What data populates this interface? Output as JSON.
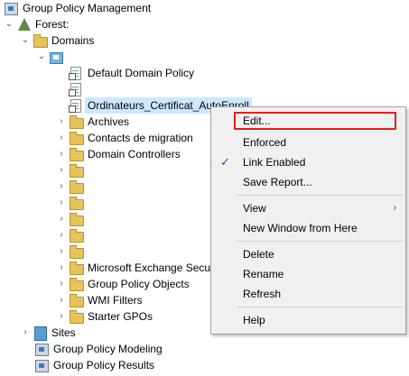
{
  "tree": {
    "root": "Group Policy Management",
    "forest": "Forest:",
    "domains": "Domains",
    "domain_node": "",
    "default_policy": "Default Domain Policy",
    "blank_gpo": "",
    "selected_gpo": "Ordinateurs_Certificat_AutoEnroll",
    "archives": "Archives",
    "contacts": "Contacts de migration",
    "domain_controllers": "Domain Controllers",
    "ms_exchange": "Microsoft Exchange Secu",
    "gpo_folder": "Group Policy Objects",
    "wmi": "WMI Filters",
    "starter": "Starter GPOs",
    "sites": "Sites",
    "modeling": "Group Policy Modeling",
    "results": "Group Policy Results"
  },
  "menu": {
    "edit": "Edit...",
    "enforced": "Enforced",
    "link_enabled": "Link Enabled",
    "save_report": "Save Report...",
    "view": "View",
    "new_window": "New Window from Here",
    "delete": "Delete",
    "rename": "Rename",
    "refresh": "Refresh",
    "help": "Help",
    "check_glyph": "✓",
    "arrow_glyph": "›"
  },
  "colors": {
    "highlight_border": "#e02020",
    "selection_bg": "#cce8ff",
    "check": "#0063b1"
  }
}
